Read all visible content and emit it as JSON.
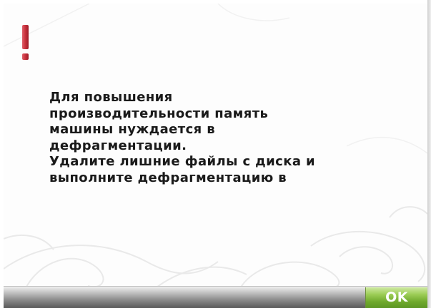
{
  "dialog": {
    "message": "Для повышения\nпроизводительности память\nмашины нуждается в\nдефрагментации.\nУдалите лишние файлы с диска и\nвыполните дефрагментацию в",
    "icon": "exclamation-icon",
    "icon_color": "#c8303c"
  },
  "footer": {
    "ok_label": "OK",
    "ok_color": "#7db33a"
  }
}
